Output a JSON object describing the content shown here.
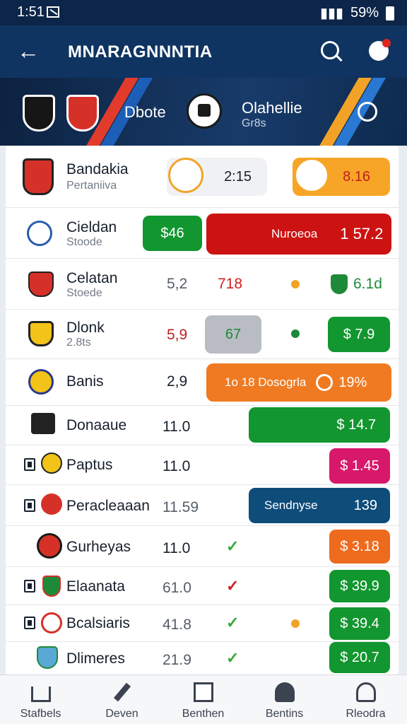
{
  "status_bar": {
    "time": "1:51",
    "battery": "59%"
  },
  "app_bar": {
    "title": "MNARAGNNNTIA",
    "back_icon": "arrow-left-icon",
    "search_icon": "search-icon",
    "profile_icon": "profile-icon"
  },
  "match": {
    "home_label": "Dbote",
    "away_name": "Olahellie",
    "away_sub": "Gr8s"
  },
  "featured": {
    "name": "Bandakia",
    "sub": "Pertaniiva",
    "odds1": "2:15",
    "odds2": "8.16"
  },
  "rows": [
    {
      "name": "Cieldan",
      "sub": "Stoode",
      "green": "$46",
      "red_label": "Nuroeoa",
      "red_value": "1 57.2"
    },
    {
      "name": "Celatan",
      "sub": "Stoede",
      "odds": "5,2",
      "red_odds": "718",
      "right": "6.1d"
    },
    {
      "name": "Dlonk",
      "sub": "2.8ts",
      "odds": "5,9",
      "gray": "67",
      "right": "$ 7.9"
    },
    {
      "name": "Banis",
      "odds": "2,9",
      "orange_label": "1o  18 Dosogrla",
      "orange_value": "19%"
    },
    {
      "name": "Donaaue",
      "odds": "11.0",
      "right": "$ 14.7"
    },
    {
      "name": "Paptus",
      "odds": "11.0",
      "right": "$ 1.45"
    },
    {
      "name": "Peracleaaan",
      "odds": "11.59",
      "right_label": "Sendnyse",
      "right": "139"
    },
    {
      "name": "Gurheyas",
      "odds": "11.0",
      "right": "$ 3.18"
    },
    {
      "name": "Elaanata",
      "odds": "61.0",
      "right": "$ 39.9"
    },
    {
      "name": "Bcalsiaris",
      "odds": "41.8",
      "right": "$ 39.4"
    },
    {
      "name": "Dlimeres",
      "odds": "21.9",
      "right": "$ 20.7"
    }
  ],
  "bottom_nav": [
    {
      "label": "Stafbels",
      "icon": "home-icon"
    },
    {
      "label": "Deven",
      "icon": "tools-icon"
    },
    {
      "label": "Benthen",
      "icon": "chart-icon"
    },
    {
      "label": "Bentins",
      "icon": "person-icon"
    },
    {
      "label": "Rleodra",
      "icon": "person-icon"
    }
  ]
}
